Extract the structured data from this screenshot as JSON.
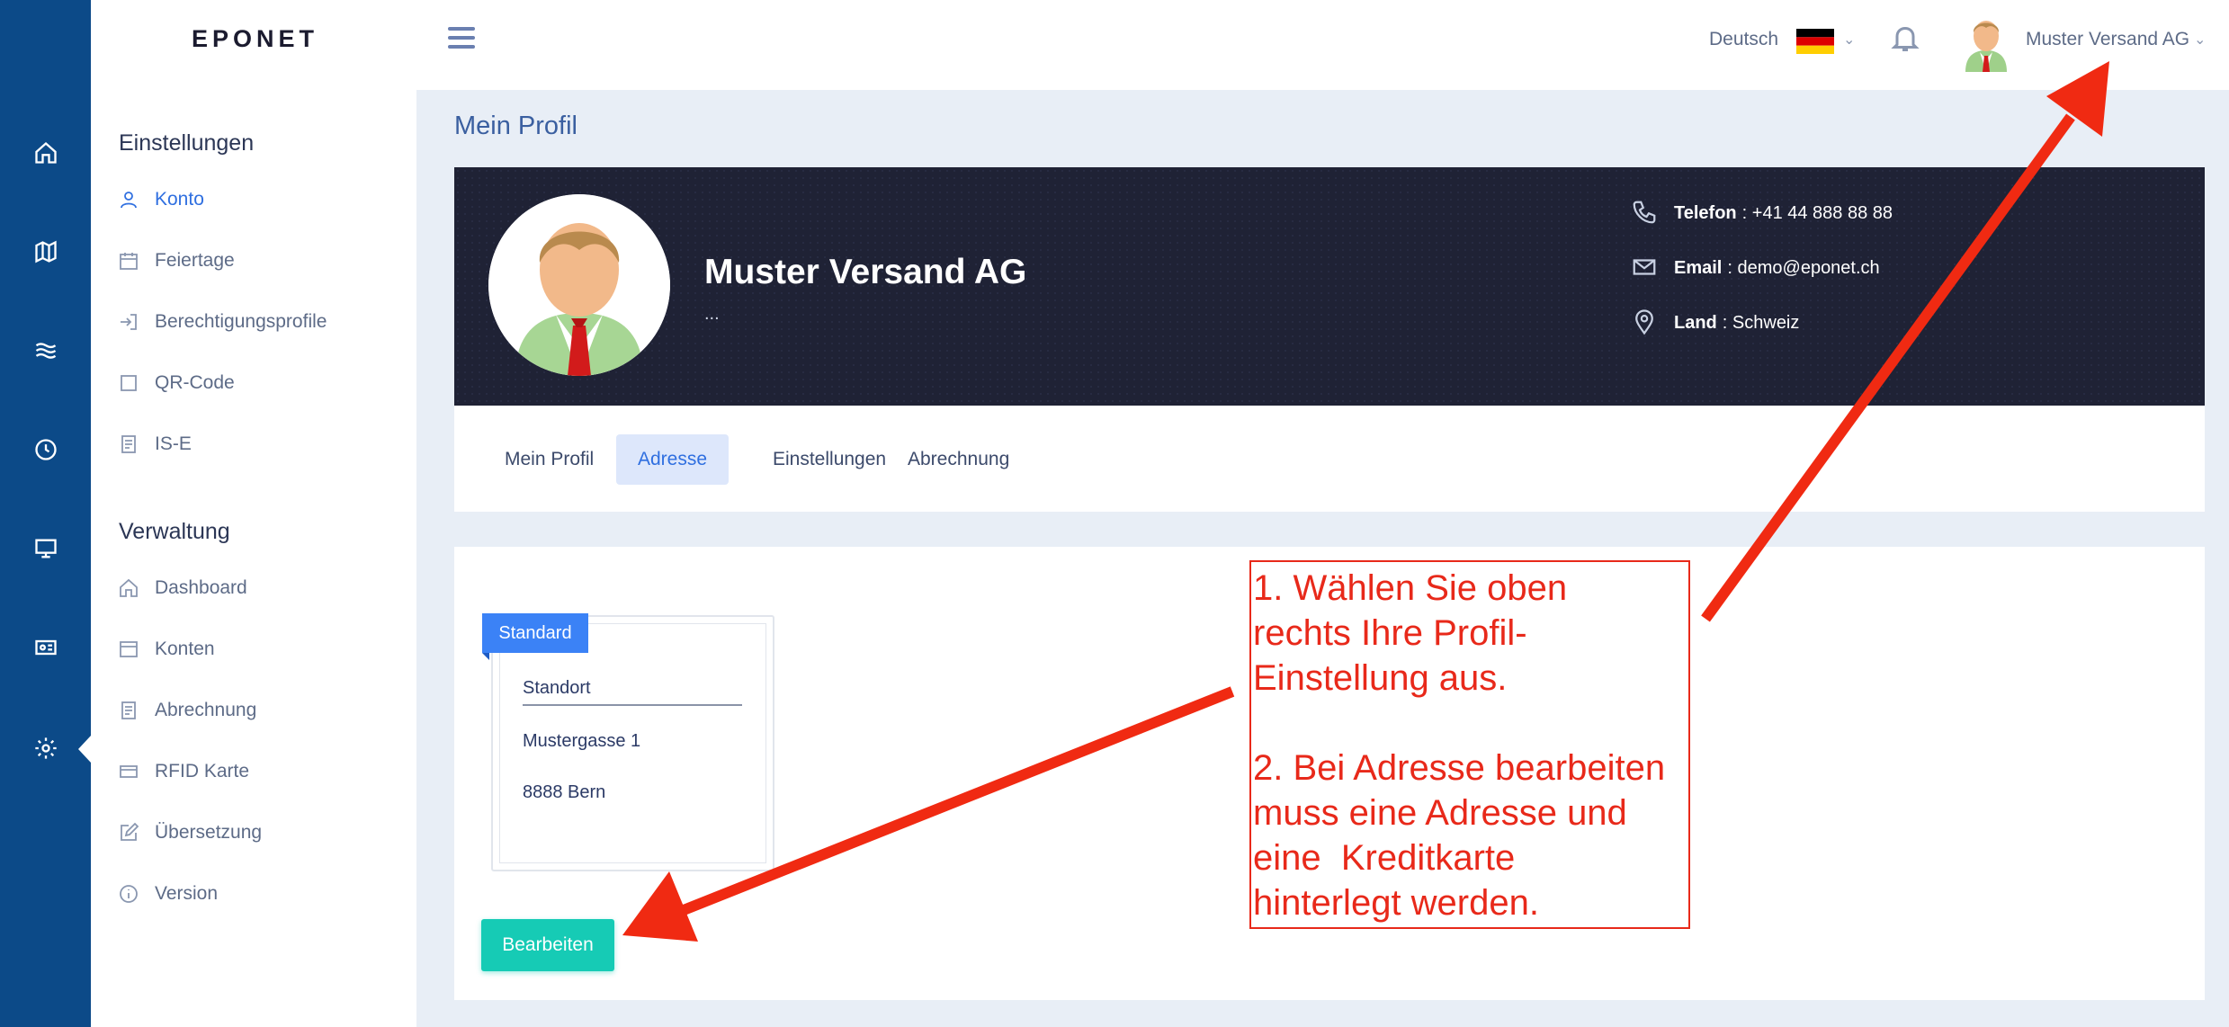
{
  "logo": "EPONET",
  "rail": {
    "icons": [
      "home-icon",
      "map-icon",
      "waves-icon",
      "clock-icon",
      "monitor-icon",
      "id-card-icon",
      "gear-icon"
    ]
  },
  "sidebar": {
    "sections": [
      {
        "title": "Einstellungen",
        "items": [
          {
            "label": "Konto",
            "icon": "user-icon",
            "active": true
          },
          {
            "label": "Feiertage",
            "icon": "calendar-icon"
          },
          {
            "label": "Berechtigungsprofile",
            "icon": "login-icon"
          },
          {
            "label": "QR-Code",
            "icon": "square-icon"
          },
          {
            "label": "IS-E",
            "icon": "document-icon"
          }
        ]
      },
      {
        "title": "Verwaltung",
        "items": [
          {
            "label": "Dashboard",
            "icon": "home-icon"
          },
          {
            "label": "Konten",
            "icon": "window-icon"
          },
          {
            "label": "Abrechnung",
            "icon": "document-icon"
          },
          {
            "label": "RFID Karte",
            "icon": "credit-card-icon"
          },
          {
            "label": "Übersetzung",
            "icon": "edit-icon"
          },
          {
            "label": "Version",
            "icon": "info-icon"
          }
        ]
      }
    ]
  },
  "topbar": {
    "language": "Deutsch",
    "flag": "germany-flag-icon",
    "user_name": "Muster Versand AG"
  },
  "page": {
    "title": "Mein Profil"
  },
  "profile": {
    "name": "Muster Versand AG",
    "subtitle": "...",
    "contacts": [
      {
        "label": "Telefon",
        "value": "+41 44 888 88 88",
        "icon": "phone-icon"
      },
      {
        "label": "Email",
        "value": "demo@eponet.ch",
        "icon": "mail-icon"
      },
      {
        "label": "Land",
        "value": "Schweiz",
        "icon": "location-pin-icon"
      }
    ]
  },
  "tabs": [
    {
      "label": "Mein Profil"
    },
    {
      "label": "Adresse",
      "active": true
    },
    {
      "label": "Einstellungen"
    },
    {
      "label": "Abrechnung"
    }
  ],
  "address": {
    "badge": "Standard",
    "title": "Standort",
    "street": "Mustergasse 1",
    "city": "8888 Bern"
  },
  "edit_button": "Bearbeiten",
  "annotation": {
    "step1": "1. Wählen Sie oben\nrechts Ihre Profil-\nEinstellung aus.",
    "step2": "2. Bei Adresse bearbeiten\nmuss eine Adresse und\neine  Kreditkarte\nhinterlegt werden.",
    "color": "#e8291a"
  },
  "colors": {
    "rail": "#0c4a88",
    "accent": "#2f6fe0",
    "button": "#16cbb5",
    "banner": "#1f2235"
  }
}
